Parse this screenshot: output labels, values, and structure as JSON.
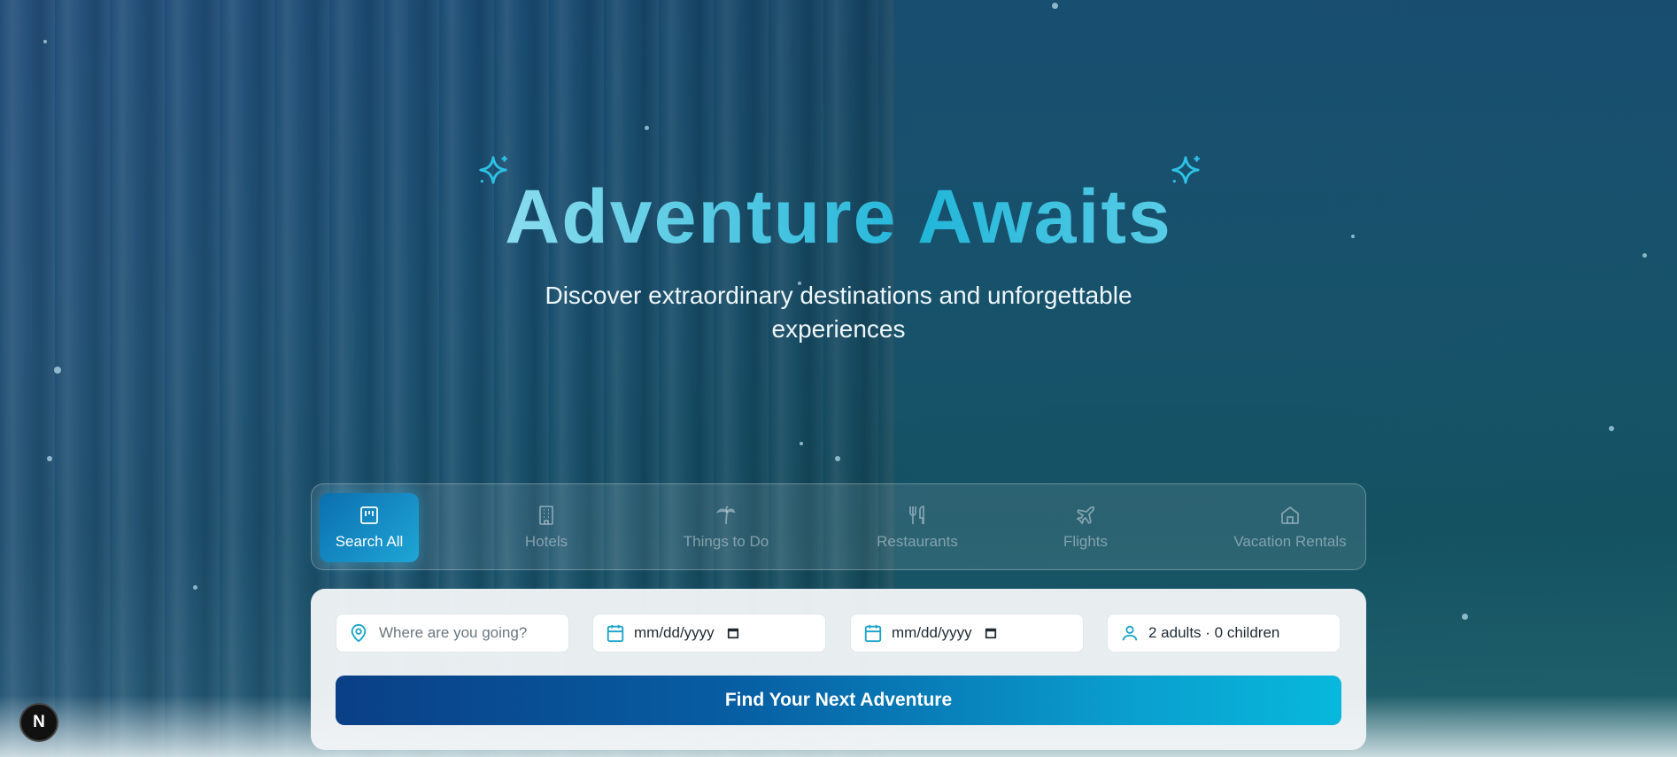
{
  "hero": {
    "title": "Adventure Awaits",
    "subtitle": "Discover extraordinary destinations and unforgettable experiences"
  },
  "tabs": [
    {
      "label": "Search All",
      "icon": "search-all-icon",
      "active": true
    },
    {
      "label": "Hotels",
      "icon": "building-icon",
      "active": false
    },
    {
      "label": "Things to Do",
      "icon": "palm-tree-icon",
      "active": false
    },
    {
      "label": "Restaurants",
      "icon": "utensils-icon",
      "active": false
    },
    {
      "label": "Flights",
      "icon": "plane-icon",
      "active": false
    },
    {
      "label": "Vacation Rentals",
      "icon": "home-icon",
      "active": false
    }
  ],
  "search": {
    "destination_placeholder": "Where are you going?",
    "checkin_value": "mm/dd/yyyy",
    "checkout_value": "mm/dd/yyyy",
    "guests_value": "2 adults · 0 children",
    "submit_label": "Find Your Next Adventure"
  },
  "badge": {
    "label": "N"
  },
  "colors": {
    "accent": "#1fa6d6",
    "cta_start": "#0a3f86",
    "cta_end": "#08b8dc",
    "icon_teal": "#1aa3c9"
  }
}
